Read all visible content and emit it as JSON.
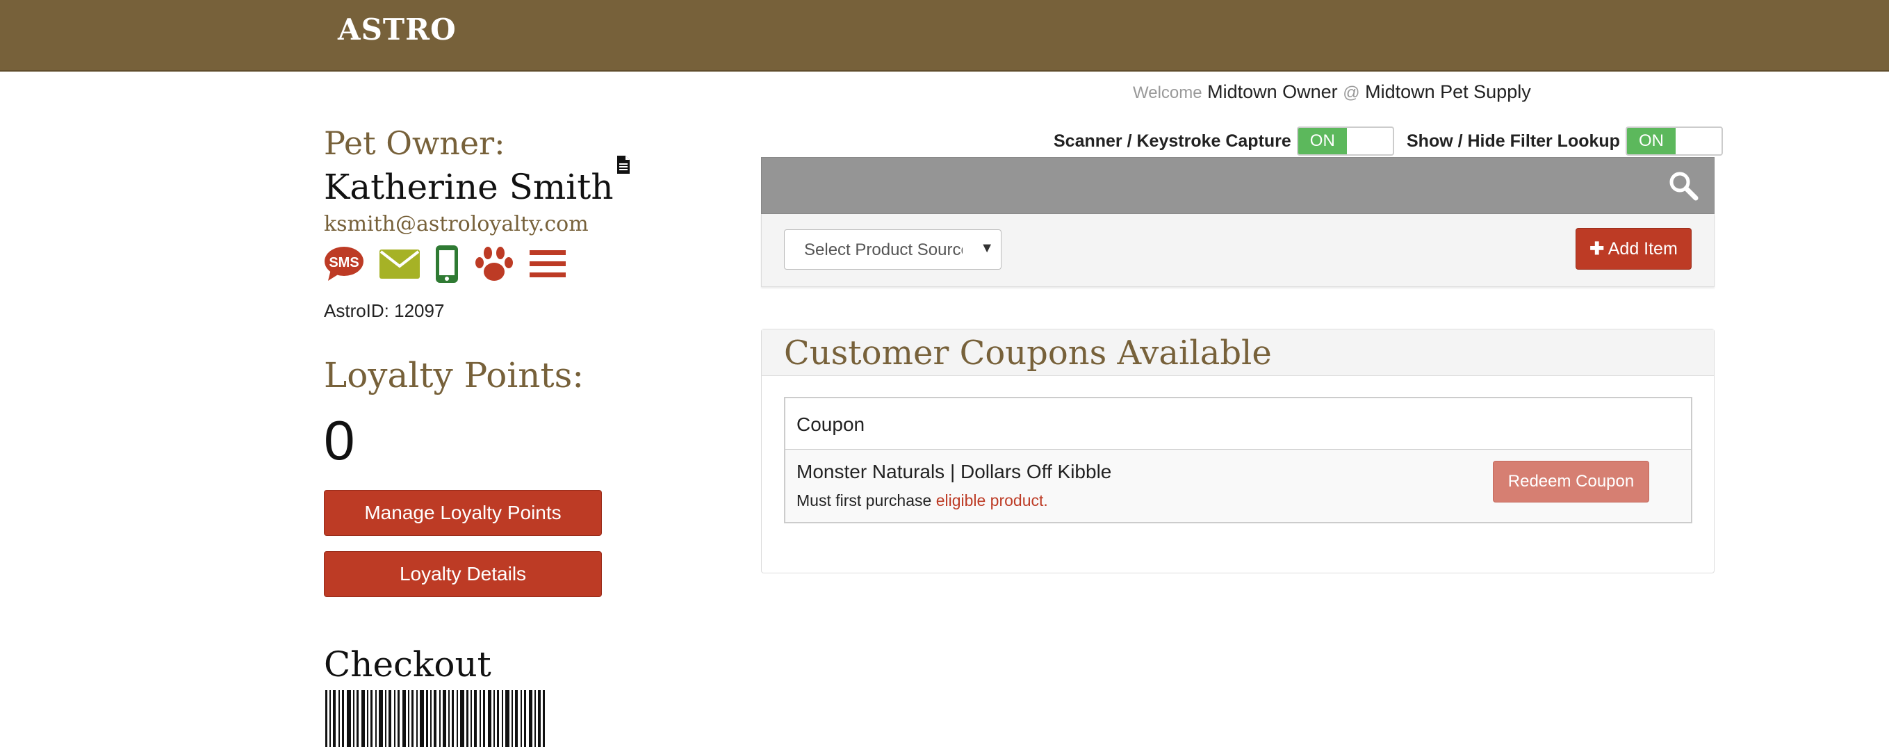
{
  "header": {
    "logo": "ASTRO"
  },
  "user": {
    "welcome_label": "Welcome",
    "name": "Midtown Owner",
    "at": "@",
    "store": "Midtown Pet Supply"
  },
  "owner": {
    "label": "Pet Owner:",
    "name": "Katherine Smith",
    "email": "ksmith@astroloyalty.com",
    "astroid": "AstroID: 12097",
    "icons": [
      "sms-icon",
      "envelope-icon",
      "mobile-icon",
      "paw-icon",
      "menu-icon",
      "document-icon"
    ],
    "sms_text": "SMS"
  },
  "loyalty": {
    "label": "Loyalty Points:",
    "value": "0",
    "manage_button": "Manage Loyalty Points",
    "details_button": "Loyalty Details"
  },
  "checkout": {
    "label": "Checkout"
  },
  "toggles": {
    "scanner_label": "Scanner / Keystroke Capture",
    "scanner_state": "ON",
    "filter_label": "Show / Hide Filter Lookup",
    "filter_state": "ON"
  },
  "product": {
    "select_value": "Select Product Source",
    "add_button": "Add Item"
  },
  "coupons": {
    "title": "Customer Coupons Available",
    "column": "Coupon",
    "rows": [
      {
        "name": "Monster Naturals | Dollars Off Kibble",
        "req_prefix": "Must first purchase",
        "req_link": "eligible product.",
        "button": "Redeem Coupon"
      }
    ]
  },
  "colors": {
    "brand": "#77613a",
    "accent_red": "#bd3b25",
    "toggle_on": "#5cb85c"
  }
}
